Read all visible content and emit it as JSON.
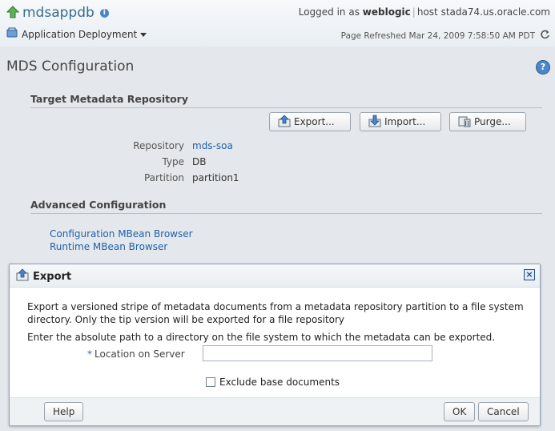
{
  "header": {
    "app_name": "mdsappdb",
    "menu_label": "Application Deployment",
    "logged_in_prefix": "Logged in as",
    "username": "weblogic",
    "host_text": "host stada74.us.oracle.com",
    "refreshed": "Page Refreshed Mar 24, 2009 7:58:50 AM PDT"
  },
  "page": {
    "title": "MDS Configuration",
    "target_section": "Target Metadata Repository",
    "buttons": {
      "export": "Export...",
      "import": "Import...",
      "purge": "Purge..."
    },
    "fields": [
      {
        "label": "Repository",
        "value": "mds-soa"
      },
      {
        "label": "Type",
        "value": "DB"
      },
      {
        "label": "Partition",
        "value": "partition1"
      }
    ],
    "advanced_section": "Advanced Configuration",
    "links": [
      "Configuration MBean Browser",
      "Runtime MBean Browser"
    ]
  },
  "dialog": {
    "title": "Export",
    "desc": "Export a versioned stripe of metadata documents from a metadata repository partition to a file system directory. Only the tip version will be exported for a file repository",
    "instruction": "Enter the absolute path to a directory on the file system to which the metadata can be exported.",
    "location_label": "Location on Server",
    "location_value": "",
    "checkbox_label": "Exclude base documents",
    "help_label": "Help",
    "ok_label": "OK",
    "cancel_label": "Cancel"
  },
  "icons": [
    "up-arrow-icon",
    "info-icon",
    "deploy-icon",
    "refresh-icon",
    "help-icon",
    "export-icon",
    "import-icon",
    "purge-icon",
    "close-icon"
  ],
  "colors": {
    "link": "#2060a8",
    "title": "#3a6b8a",
    "accent": "#4a86c8"
  }
}
